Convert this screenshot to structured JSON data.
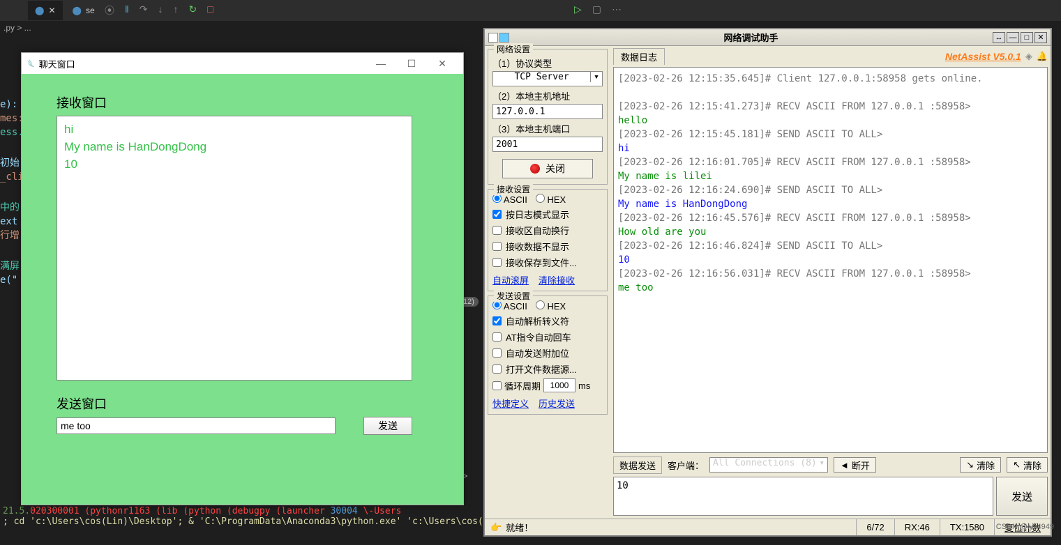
{
  "vscode": {
    "tab_prefix": "se",
    "breadcrumb": ".py > ...",
    "toolbar_icons": [
      "⦿",
      "‖",
      "↷",
      "↓",
      "↑",
      "↻",
      "□"
    ],
    "right_icons": [
      "▷",
      "▢",
      "⋯"
    ],
    "code_fragments": [
      "e):",
      "mes:",
      "ess.",
      "初始",
      "_cli",
      "中的",
      "ext",
      "行增",
      "满屏",
      "e(\""
    ],
    "line_badge": "12)",
    "terminal_line1_parts": [
      "21.5.",
      "020300001 (pythonr1163 (lib (python (debugpy (launcher",
      "  30004",
      "  \\-Users"
    ],
    "terminal_line2": "; cd 'c:\\Users\\cos(Lin)\\Desktop'; & 'C:\\ProgramData\\Anaconda3\\python.exe' 'c:\\Users\\cos(Lin)\\.vscod",
    "sc_hint": "sc >"
  },
  "chat": {
    "title": "聊天窗口",
    "recv_label": "接收窗口",
    "recv_lines": [
      "hi",
      "My name is HanDongDong",
      "10"
    ],
    "send_label": "发送窗口",
    "send_value": "me too",
    "send_btn": "发送"
  },
  "na": {
    "title": "网络调试助手",
    "brand": "NetAssist V5.0.1",
    "groups": {
      "net": "网络设置",
      "recv": "接收设置",
      "send": "发送设置"
    },
    "net": {
      "proto_label": "（1）协议类型",
      "proto_value": "TCP Server",
      "host_label": "（2）本地主机地址",
      "host_value": "127.0.0.1",
      "port_label": "（3）本地主机端口",
      "port_value": "2001",
      "close_btn": "关闭"
    },
    "recv": {
      "ascii": "ASCII",
      "hex": "HEX",
      "opt1": "按日志模式显示",
      "opt2": "接收区自动换行",
      "opt3": "接收数据不显示",
      "opt4": "接收保存到文件...",
      "link1": "自动滚屏",
      "link2": "清除接收"
    },
    "send": {
      "ascii": "ASCII",
      "hex": "HEX",
      "opt1": "自动解析转义符",
      "opt2": "AT指令自动回车",
      "opt3": "自动发送附加位",
      "opt4": "打开文件数据源...",
      "period_label": "循环周期",
      "period_value": "1000",
      "period_unit": "ms",
      "link1": "快捷定义",
      "link2": "历史发送"
    },
    "log_tab": "数据日志",
    "log": [
      {
        "c": "ts",
        "t": "[2023-02-26 12:15:35.645]# Client 127.0.0.1:58958 gets online."
      },
      {
        "c": "",
        "t": ""
      },
      {
        "c": "ts",
        "t": "[2023-02-26 12:15:41.273]# RECV ASCII FROM 127.0.0.1 :58958>"
      },
      {
        "c": "gr",
        "t": "hello"
      },
      {
        "c": "ts",
        "t": "[2023-02-26 12:15:45.181]# SEND ASCII TO ALL>"
      },
      {
        "c": "bl",
        "t": "hi"
      },
      {
        "c": "ts",
        "t": "[2023-02-26 12:16:01.705]# RECV ASCII FROM 127.0.0.1 :58958>"
      },
      {
        "c": "gr",
        "t": "My name is lilei"
      },
      {
        "c": "ts",
        "t": "[2023-02-26 12:16:24.690]# SEND ASCII TO ALL>"
      },
      {
        "c": "bl",
        "t": "My name is HanDongDong"
      },
      {
        "c": "ts",
        "t": "[2023-02-26 12:16:45.576]# RECV ASCII FROM 127.0.0.1 :58958>"
      },
      {
        "c": "gr",
        "t": "How old are you"
      },
      {
        "c": "ts",
        "t": "[2023-02-26 12:16:46.824]# SEND ASCII TO ALL>"
      },
      {
        "c": "bl",
        "t": "10"
      },
      {
        "c": "ts",
        "t": "[2023-02-26 12:16:56.031]# RECV ASCII FROM 127.0.0.1 :58958>"
      },
      {
        "c": "gr",
        "t": "me too"
      }
    ],
    "sendbar": {
      "tab": "数据发送",
      "client_label": "客户端：",
      "conn": "All Connections (8)",
      "disconnect": "断开",
      "clear1": "清除",
      "clear2": "清除",
      "value": "10",
      "btn": "发送"
    },
    "status": {
      "ready": "就绪！",
      "pos": "6/72",
      "rx": "RX:46",
      "tx": "TX:1580",
      "reset": "复位计数"
    }
  },
  "watermark": "CSDN @lyx4949"
}
